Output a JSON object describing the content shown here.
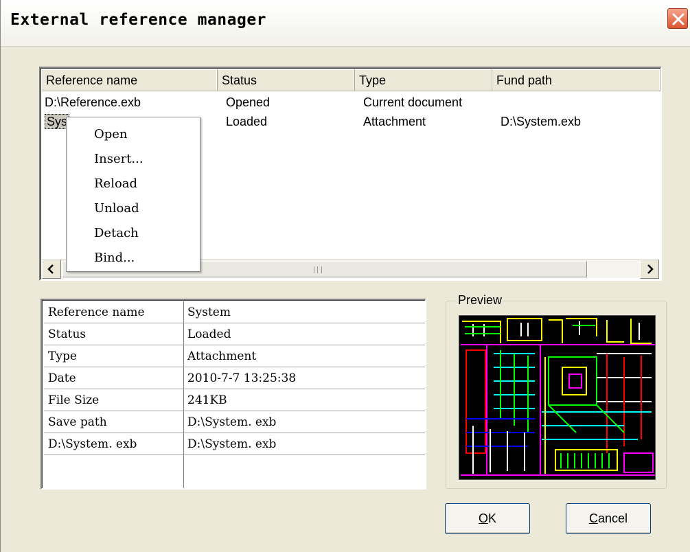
{
  "window": {
    "title": "External reference manager"
  },
  "reference_list": {
    "columns": [
      "Reference name",
      "Status",
      "Type",
      "Fund path"
    ],
    "rows": [
      {
        "name": "D:\\Reference.exb",
        "status": "Opened",
        "type": "Current document",
        "path": ""
      },
      {
        "name": "Sys",
        "status": "Loaded",
        "type": "Attachment",
        "path": "D:\\System.exb"
      }
    ]
  },
  "context_menu": {
    "items": [
      "Open",
      "Insert...",
      "Reload",
      "Unload",
      "Detach",
      "Bind..."
    ]
  },
  "details": {
    "rows": [
      {
        "key": "Reference name",
        "value": "System"
      },
      {
        "key": "Status",
        "value": "Loaded"
      },
      {
        "key": "Type",
        "value": "Attachment"
      },
      {
        "key": "Date",
        "value": "2010-7-7 13:25:38"
      },
      {
        "key": "File Size",
        "value": "241KB"
      },
      {
        "key": "Save path",
        "value": "D:\\System. exb"
      },
      {
        "key": "D:\\System. exb",
        "value": "D:\\System. exb"
      }
    ]
  },
  "preview": {
    "label": "Preview"
  },
  "buttons": {
    "ok": {
      "mnemonic": "O",
      "rest": "K"
    },
    "cancel": {
      "mnemonic": "C",
      "rest": "ancel"
    }
  }
}
